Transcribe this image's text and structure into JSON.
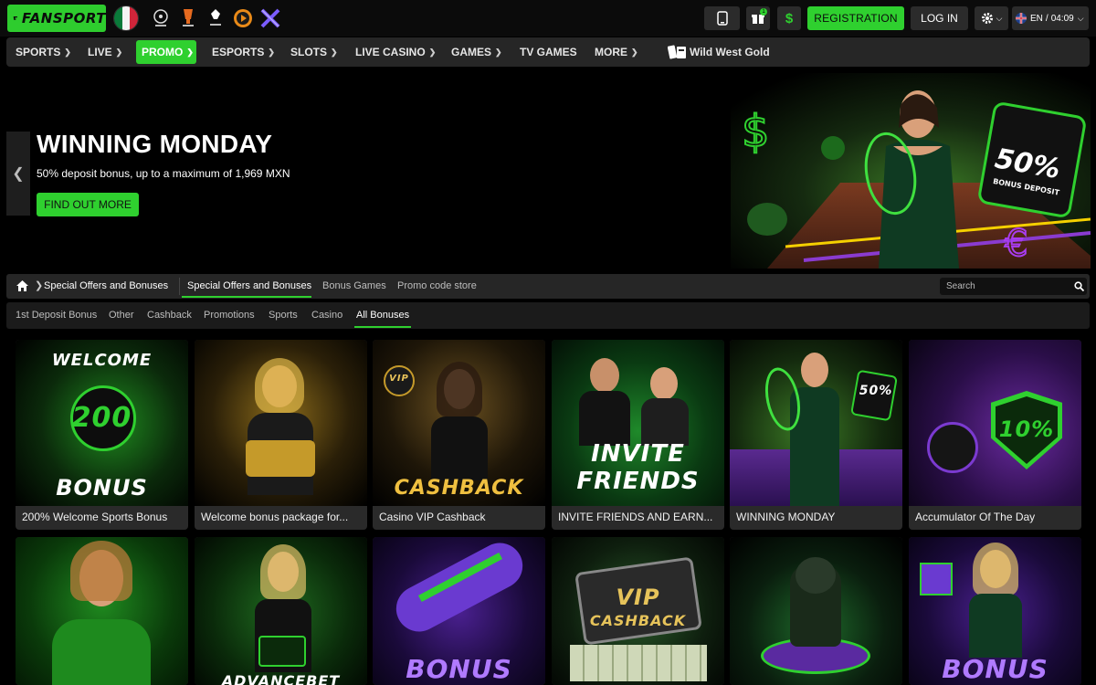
{
  "brand": {
    "name": "FANSPORT",
    "accent": "#2fd02f"
  },
  "header": {
    "registration_label": "REGISTRATION",
    "login_label": "LOG IN",
    "language": "EN",
    "time": "04:09",
    "gift_count": "1"
  },
  "nav": {
    "items": [
      {
        "label": "SPORTS"
      },
      {
        "label": "LIVE"
      },
      {
        "label": "PROMO"
      },
      {
        "label": "ESPORTS"
      },
      {
        "label": "SLOTS"
      },
      {
        "label": "LIVE CASINO"
      },
      {
        "label": "GAMES"
      },
      {
        "label": "TV GAMES"
      },
      {
        "label": "MORE"
      }
    ],
    "featured": "Wild West Gold"
  },
  "hero": {
    "title": "WINNING MONDAY",
    "subtitle": "50% deposit bonus, up to a maximum of 1,969 MXN",
    "cta": "FIND OUT MORE",
    "badge_value": "50%",
    "badge_text": "BONUS DEPOSIT"
  },
  "breadcrumb": {
    "label": "Special Offers and Bonuses"
  },
  "page_tabs": [
    {
      "label": "Special Offers and Bonuses"
    },
    {
      "label": "Bonus Games"
    },
    {
      "label": "Promo code store"
    }
  ],
  "search": {
    "placeholder": "Search"
  },
  "filters": [
    {
      "label": "1st Deposit Bonus"
    },
    {
      "label": "Other"
    },
    {
      "label": "Cashback"
    },
    {
      "label": "Promotions"
    },
    {
      "label": "Sports"
    },
    {
      "label": "Casino"
    },
    {
      "label": "All Bonuses"
    }
  ],
  "cards": [
    {
      "caption": "200% Welcome Sports Bonus",
      "art_top": "WELCOME",
      "art_mid": "200",
      "art_bottom": "BONUS"
    },
    {
      "caption": "Welcome bonus package for...",
      "art_top": "",
      "art_mid": "",
      "art_bottom": ""
    },
    {
      "caption": "Casino VIP Cashback",
      "art_top": "VIP",
      "art_mid": "",
      "art_bottom": "CASHBACK"
    },
    {
      "caption": "INVITE FRIENDS AND EARN...",
      "art_top": "",
      "art_mid": "INVITE",
      "art_bottom": "FRIENDS"
    },
    {
      "caption": "WINNING MONDAY",
      "art_top": "50%",
      "art_mid": "",
      "art_bottom": ""
    },
    {
      "caption": "Accumulator Of The Day",
      "art_top": "",
      "art_mid": "10%",
      "art_bottom": ""
    },
    {
      "caption": "",
      "art_top": "",
      "art_mid": "",
      "art_bottom": ""
    },
    {
      "caption": "",
      "art_top": "",
      "art_mid": "",
      "art_bottom": "ADVANCEBET"
    },
    {
      "caption": "",
      "art_top": "",
      "art_mid": "",
      "art_bottom": "BONUS"
    },
    {
      "caption": "",
      "art_top": "VIP",
      "art_mid": "CASHBACK",
      "art_bottom": ""
    },
    {
      "caption": "",
      "art_top": "",
      "art_mid": "",
      "art_bottom": ""
    },
    {
      "caption": "",
      "art_top": "",
      "art_mid": "",
      "art_bottom": "BONUS"
    }
  ]
}
